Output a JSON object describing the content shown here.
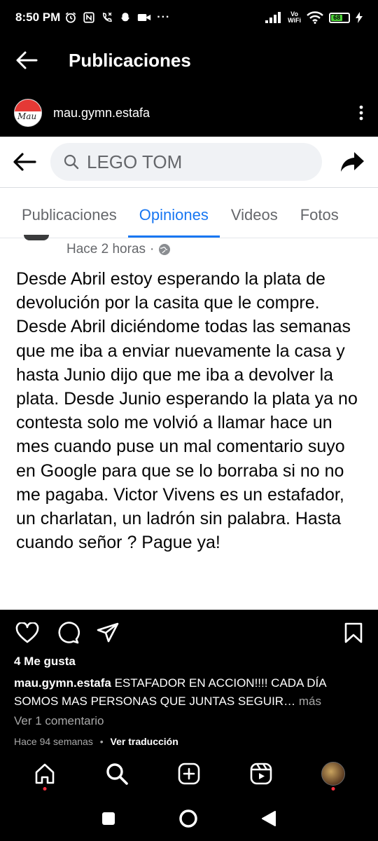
{
  "status_bar": {
    "time": "8:50 PM",
    "vowifi_line1": "Vo",
    "vowifi_line2": "WiFi",
    "battery": "68"
  },
  "header": {
    "title": "Publicaciones"
  },
  "account": {
    "avatar_text": "Mau",
    "username": "mau.gymn.estafa"
  },
  "facebook_screenshot": {
    "search_query": "LEGO TOM",
    "tabs": [
      {
        "label": "Publicaciones"
      },
      {
        "label": "Opiniones"
      },
      {
        "label": "Videos"
      },
      {
        "label": "Fotos"
      }
    ],
    "active_tab": "Opiniones",
    "post_time": "Hace 2 horas",
    "post_separator": "·",
    "post_text": "Desde Abril estoy esperando la plata de devolución por la casita que le compre. Desde Abril diciéndome todas las semanas que me iba a enviar nuevamente la casa y hasta Junio dijo que me iba a devolver la plata. Desde Junio esperando la plata ya no contesta solo me volvió a llamar hace un mes cuando puse un mal comentario suyo en Google para que se lo borraba si no no me pagaba. Victor Vivens es un estafador, un charlatan, un ladrón sin palabra. Hasta cuando señor ? Pague ya!"
  },
  "post_footer": {
    "likes": "4 Me gusta",
    "caption_user": "mau.gymn.estafa",
    "caption_text": "ESTAFADOR EN ACCION!!!! CADA DÍA SOMOS MAS PERSONAS QUE JUNTAS SEGUIR…",
    "caption_more": "más",
    "comments_link": "Ver 1 comentario",
    "time_ago": "Hace 94 semanas",
    "separator": "•",
    "translate_link": "Ver traducción"
  },
  "colors": {
    "fb_blue": "#1877f2",
    "notification_dot": "#ff3040",
    "battery_green": "#4cd137"
  }
}
